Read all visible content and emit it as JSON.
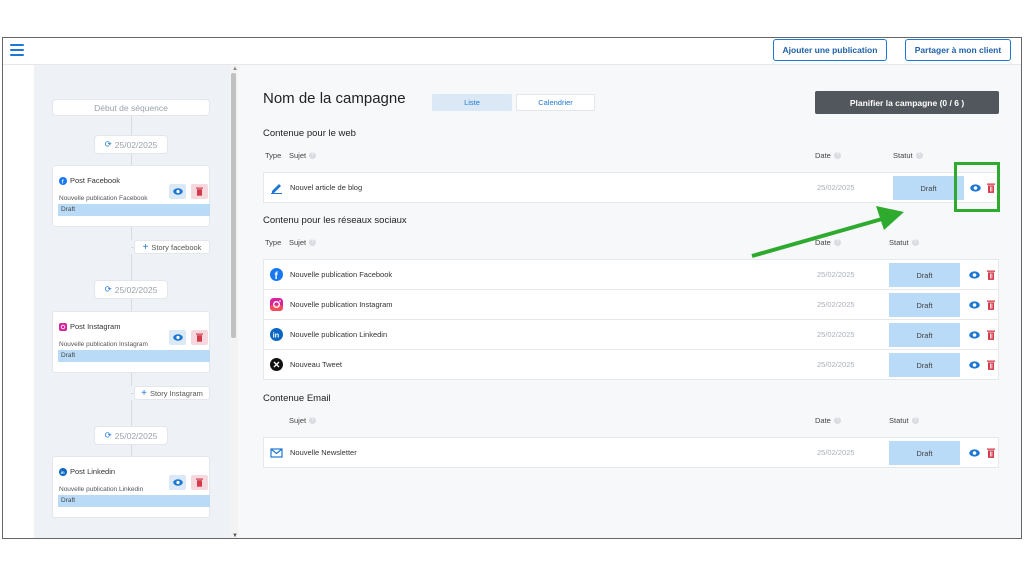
{
  "topbar": {
    "add_publication": "Ajouter une publication",
    "share_client": "Partager à mon client"
  },
  "sequence": {
    "start": "Début de séquence",
    "dates": [
      "25/02/2025",
      "25/02/2025",
      "25/02/2025"
    ],
    "cards": [
      {
        "title": "Post Facebook",
        "subtitle": "Nouvelle publication Facebook",
        "status": "Draft",
        "icon": "facebook-icon"
      },
      {
        "title": "Post Instagram",
        "subtitle": "Nouvelle publication Instagram",
        "status": "Draft",
        "icon": "instagram-icon"
      },
      {
        "title": "Post Linkedin",
        "subtitle": "Nouvelle publication Linkedin",
        "status": "Draft",
        "icon": "linkedin-icon"
      }
    ],
    "stories": [
      "Story facebook",
      "Story Instagram"
    ]
  },
  "main": {
    "campaign_title": "Nom de la campagne",
    "tabs": [
      "Liste",
      "Calendrier"
    ],
    "plan_button": "Planifier la campagne (0 / 6 )",
    "columns": {
      "type": "Type",
      "subject": "Sujet",
      "date": "Date",
      "status": "Statut"
    },
    "sections": [
      {
        "title": "Contenue pour le web",
        "rows": [
          {
            "icon": "pencil-icon",
            "subject": "Nouvel article de blog",
            "date": "25/02/2025",
            "status": "Draft"
          }
        ]
      },
      {
        "title": "Contenu pour les réseaux sociaux",
        "rows": [
          {
            "icon": "facebook-icon",
            "subject": "Nouvelle publication Facebook",
            "date": "25/02/2025",
            "status": "Draft"
          },
          {
            "icon": "instagram-icon",
            "subject": "Nouvelle publication Instagram",
            "date": "25/02/2025",
            "status": "Draft"
          },
          {
            "icon": "linkedin-icon",
            "subject": "Nouvelle publication Linkedin",
            "date": "25/02/2025",
            "status": "Draft"
          },
          {
            "icon": "x-icon",
            "subject": "Nouveau Tweet",
            "date": "25/02/2025",
            "status": "Draft"
          }
        ]
      },
      {
        "title": "Contenue Email",
        "rows": [
          {
            "icon": "mail-icon",
            "subject": "Nouvelle Newsletter",
            "date": "25/02/2025",
            "status": "Draft"
          }
        ]
      }
    ]
  },
  "colors": {
    "accent": "#1e78d2",
    "draft_bg": "#b9dbf7",
    "delete": "#d33a4a",
    "highlight": "#2eaa2e",
    "plan_button": "#52575d"
  }
}
